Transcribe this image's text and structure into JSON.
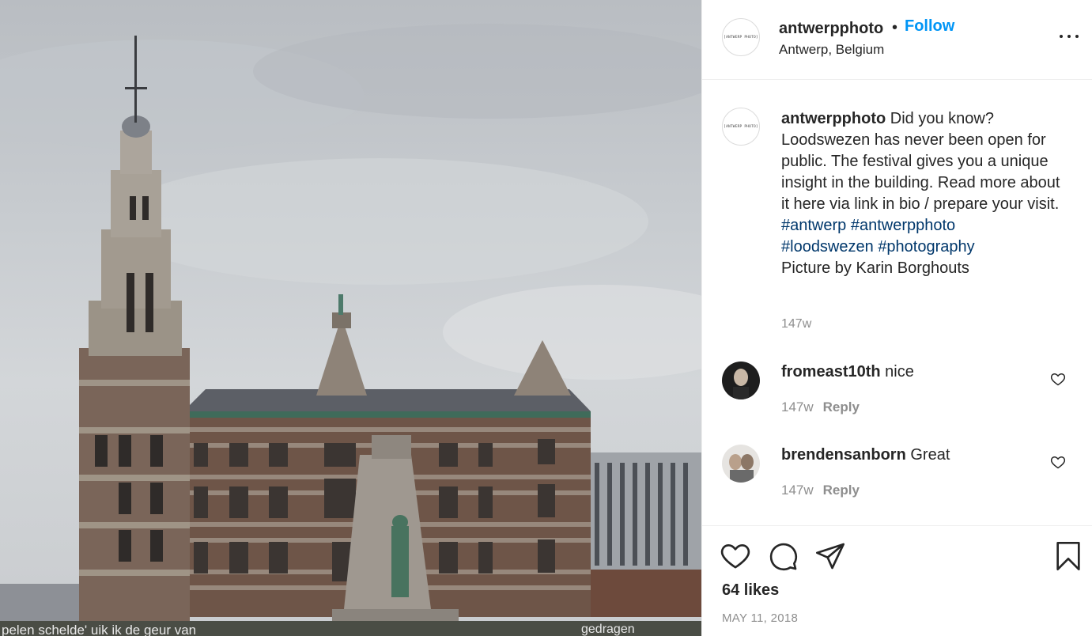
{
  "post": {
    "username": "antwerpphoto",
    "separator": "•",
    "follow_label": "Follow",
    "location": "Antwerp, Belgium",
    "avatar_logo_text": "[ANTWERP PHOTO]",
    "more_icon": "more-horizontal-icon",
    "photo_banner_text": "pelen schelde' uik ik de geur van",
    "photo_banner_text_right": "gedragen"
  },
  "caption": {
    "username": "antwerpphoto",
    "text": "Did you know? Loodswezen has never been open for public. The festival gives you a unique insight in the building. Read more about it here via link in bio / prepare your visit.",
    "hashtags": [
      "#antwerp",
      "#antwerpphoto",
      "#loodswezen",
      "#photography"
    ],
    "credit": "Picture by Karin Borghouts",
    "time": "147w"
  },
  "comments": [
    {
      "username": "fromeast10th",
      "text": "nice",
      "time": "147w",
      "reply_label": "Reply",
      "like_icon": "heart-outline-icon"
    },
    {
      "username": "brendensanborn",
      "text": "Great",
      "time": "147w",
      "reply_label": "Reply",
      "like_icon": "heart-outline-icon"
    }
  ],
  "actions": {
    "icons": [
      "heart-outline-icon",
      "comment-icon",
      "share-icon",
      "bookmark-icon"
    ],
    "likes": "64 likes",
    "date": "MAY 11, 2018"
  },
  "colors": {
    "link_blue": "#0095f6",
    "hashtag": "#00376b",
    "muted": "#8e8e8e"
  }
}
